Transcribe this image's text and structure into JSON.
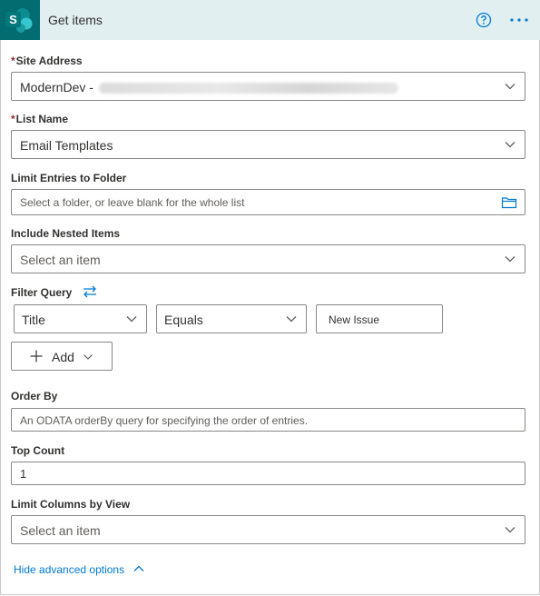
{
  "header": {
    "title": "Get items",
    "app_icon_letter": "S",
    "help_icon": "help-circle-icon",
    "more_icon": "more-ellipsis-icon",
    "accent": "#036c70",
    "header_bg": "#e1eff0"
  },
  "fields": {
    "site_address": {
      "label": "Site Address",
      "required_mark": "*",
      "value": "ModernDev -"
    },
    "list_name": {
      "label": "List Name",
      "required_mark": "*",
      "value": "Email Templates"
    },
    "limit_folder": {
      "label": "Limit Entries to Folder",
      "placeholder": "Select a folder, or leave blank for the whole list"
    },
    "nested_items": {
      "label": "Include Nested Items",
      "placeholder": "Select an item"
    },
    "filter_query": {
      "label": "Filter Query",
      "field": "Title",
      "operator": "Equals",
      "value": "New Issue",
      "add_label": "Add"
    },
    "order_by": {
      "label": "Order By",
      "placeholder": "An ODATA orderBy query for specifying the order of entries."
    },
    "top_count": {
      "label": "Top Count",
      "value": "1"
    },
    "limit_columns": {
      "label": "Limit Columns by View",
      "placeholder": "Select an item"
    }
  },
  "footer": {
    "hide_advanced": "Hide advanced options"
  },
  "colors": {
    "link": "#0078d4",
    "required": "#a4262c",
    "border": "#8a8886"
  }
}
